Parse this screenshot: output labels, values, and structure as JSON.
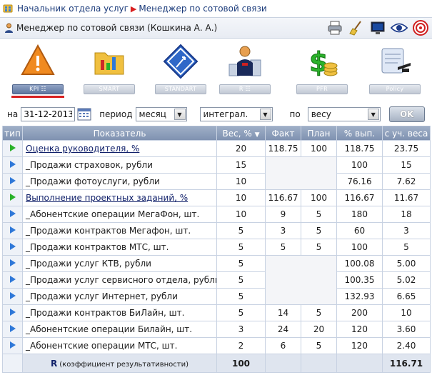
{
  "breadcrumb": {
    "root": "Начальник отдела услуг",
    "current": "Менеджер по сотовой связи"
  },
  "header": {
    "title": "Менеджер по сотовой связи  (Кошкина А. А.)"
  },
  "toolbar_icons": [
    "printer-icon",
    "broom-icon",
    "monitor-icon",
    "eye-icon",
    "target-icon"
  ],
  "nav": {
    "items": [
      {
        "label": "KPI ☷",
        "icon": "warning-icon",
        "active": true
      },
      {
        "label": "SMART",
        "icon": "folder-chart-icon",
        "active": false
      },
      {
        "label": "STANDART",
        "icon": "goal-sign-icon",
        "active": false
      },
      {
        "label": "R ☷",
        "icon": "rating-person-icon",
        "active": false
      },
      {
        "label": "PFR",
        "icon": "dollar-coins-icon",
        "active": false
      },
      {
        "label": "Policy",
        "icon": "diploma-icon",
        "active": false
      }
    ]
  },
  "filter": {
    "on_label": "на",
    "date": "31-12-2013",
    "period_label": "период",
    "period": "месяц",
    "mode": "интеграл.",
    "by_label": "по",
    "by": "весу",
    "ok": "OK"
  },
  "table": {
    "headers": [
      "тип",
      "Показатель",
      "Вес, %",
      "Факт",
      "План",
      "% вып.",
      "с уч. веса"
    ],
    "rows": [
      {
        "kind": "main",
        "name": "Оценка руководителя, %",
        "weight": "20",
        "fact": "118.75",
        "plan": "100",
        "pct": "118.75",
        "weighted": "23.75",
        "red": false
      },
      {
        "kind": "sub",
        "name": "_Продажи страховок, рубли",
        "weight": "15",
        "fact": "",
        "plan": "",
        "pct": "100",
        "weighted": "15",
        "red": false
      },
      {
        "kind": "sub",
        "name": "_Продажи фотоуслуги, рубли",
        "weight": "10",
        "fact": "",
        "plan": "",
        "pct": "76.16",
        "weighted": "7.62",
        "red": false
      },
      {
        "kind": "main",
        "name": "Выполнение проектных заданий, %",
        "weight": "10",
        "fact": "116.67",
        "plan": "100",
        "pct": "116.67",
        "weighted": "11.67",
        "red": false
      },
      {
        "kind": "sub",
        "name": "_Абонентские операции МегаФон, шт.",
        "weight": "10",
        "fact": "9",
        "plan": "5",
        "pct": "180",
        "weighted": "18",
        "red": true
      },
      {
        "kind": "sub",
        "name": "_Продажи контрактов Мегафон, шт.",
        "weight": "5",
        "fact": "3",
        "plan": "5",
        "pct": "60",
        "weighted": "3",
        "red": true
      },
      {
        "kind": "sub",
        "name": "_Продажи контрактов МТС, шт.",
        "weight": "5",
        "fact": "5",
        "plan": "5",
        "pct": "100",
        "weighted": "5",
        "red": false
      },
      {
        "kind": "sub",
        "name": "_Продажи услуг КТВ, рубли",
        "weight": "5",
        "fact": "",
        "plan": "",
        "pct": "100.08",
        "weighted": "5.00",
        "red": false
      },
      {
        "kind": "sub",
        "name": "_Продажи услуг сервисного отдела, рубли",
        "weight": "5",
        "fact": "",
        "plan": "",
        "pct": "100.35",
        "weighted": "5.02",
        "red": false
      },
      {
        "kind": "sub",
        "name": "_Продажи услуг Интернет, рубли",
        "weight": "5",
        "fact": "",
        "plan": "",
        "pct": "132.93",
        "weighted": "6.65",
        "red": false
      },
      {
        "kind": "sub",
        "name": "_Продажи контрактов БиЛайн, шт.",
        "weight": "5",
        "fact": "14",
        "plan": "5",
        "pct": "200",
        "weighted": "10",
        "red": false
      },
      {
        "kind": "sub",
        "name": "_Абонентские операции Билайн, шт.",
        "weight": "3",
        "fact": "24",
        "plan": "20",
        "pct": "120",
        "weighted": "3.60",
        "red": true
      },
      {
        "kind": "sub",
        "name": "_Абонентские операции МТС, шт.",
        "weight": "2",
        "fact": "6",
        "plan": "5",
        "pct": "120",
        "weighted": "2.40",
        "red": true
      }
    ],
    "total": {
      "r": "R",
      "label": "(коэффициент результативности)",
      "weight": "100",
      "weighted": "116.71"
    }
  }
}
